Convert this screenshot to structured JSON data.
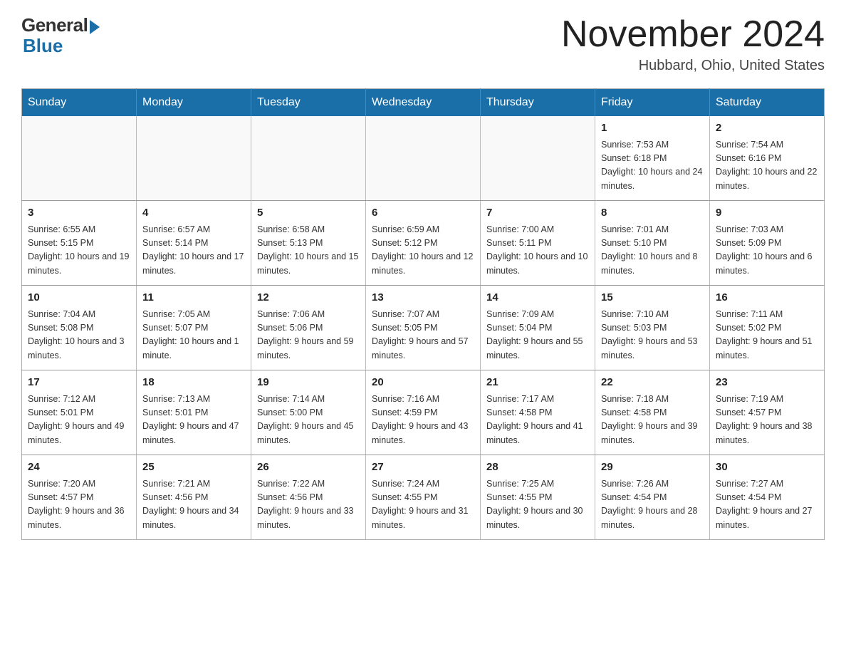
{
  "logo": {
    "general": "General",
    "blue": "Blue"
  },
  "title": "November 2024",
  "location": "Hubbard, Ohio, United States",
  "days_of_week": [
    "Sunday",
    "Monday",
    "Tuesday",
    "Wednesday",
    "Thursday",
    "Friday",
    "Saturday"
  ],
  "weeks": [
    [
      {
        "day": "",
        "info": ""
      },
      {
        "day": "",
        "info": ""
      },
      {
        "day": "",
        "info": ""
      },
      {
        "day": "",
        "info": ""
      },
      {
        "day": "",
        "info": ""
      },
      {
        "day": "1",
        "info": "Sunrise: 7:53 AM\nSunset: 6:18 PM\nDaylight: 10 hours and 24 minutes."
      },
      {
        "day": "2",
        "info": "Sunrise: 7:54 AM\nSunset: 6:16 PM\nDaylight: 10 hours and 22 minutes."
      }
    ],
    [
      {
        "day": "3",
        "info": "Sunrise: 6:55 AM\nSunset: 5:15 PM\nDaylight: 10 hours and 19 minutes."
      },
      {
        "day": "4",
        "info": "Sunrise: 6:57 AM\nSunset: 5:14 PM\nDaylight: 10 hours and 17 minutes."
      },
      {
        "day": "5",
        "info": "Sunrise: 6:58 AM\nSunset: 5:13 PM\nDaylight: 10 hours and 15 minutes."
      },
      {
        "day": "6",
        "info": "Sunrise: 6:59 AM\nSunset: 5:12 PM\nDaylight: 10 hours and 12 minutes."
      },
      {
        "day": "7",
        "info": "Sunrise: 7:00 AM\nSunset: 5:11 PM\nDaylight: 10 hours and 10 minutes."
      },
      {
        "day": "8",
        "info": "Sunrise: 7:01 AM\nSunset: 5:10 PM\nDaylight: 10 hours and 8 minutes."
      },
      {
        "day": "9",
        "info": "Sunrise: 7:03 AM\nSunset: 5:09 PM\nDaylight: 10 hours and 6 minutes."
      }
    ],
    [
      {
        "day": "10",
        "info": "Sunrise: 7:04 AM\nSunset: 5:08 PM\nDaylight: 10 hours and 3 minutes."
      },
      {
        "day": "11",
        "info": "Sunrise: 7:05 AM\nSunset: 5:07 PM\nDaylight: 10 hours and 1 minute."
      },
      {
        "day": "12",
        "info": "Sunrise: 7:06 AM\nSunset: 5:06 PM\nDaylight: 9 hours and 59 minutes."
      },
      {
        "day": "13",
        "info": "Sunrise: 7:07 AM\nSunset: 5:05 PM\nDaylight: 9 hours and 57 minutes."
      },
      {
        "day": "14",
        "info": "Sunrise: 7:09 AM\nSunset: 5:04 PM\nDaylight: 9 hours and 55 minutes."
      },
      {
        "day": "15",
        "info": "Sunrise: 7:10 AM\nSunset: 5:03 PM\nDaylight: 9 hours and 53 minutes."
      },
      {
        "day": "16",
        "info": "Sunrise: 7:11 AM\nSunset: 5:02 PM\nDaylight: 9 hours and 51 minutes."
      }
    ],
    [
      {
        "day": "17",
        "info": "Sunrise: 7:12 AM\nSunset: 5:01 PM\nDaylight: 9 hours and 49 minutes."
      },
      {
        "day": "18",
        "info": "Sunrise: 7:13 AM\nSunset: 5:01 PM\nDaylight: 9 hours and 47 minutes."
      },
      {
        "day": "19",
        "info": "Sunrise: 7:14 AM\nSunset: 5:00 PM\nDaylight: 9 hours and 45 minutes."
      },
      {
        "day": "20",
        "info": "Sunrise: 7:16 AM\nSunset: 4:59 PM\nDaylight: 9 hours and 43 minutes."
      },
      {
        "day": "21",
        "info": "Sunrise: 7:17 AM\nSunset: 4:58 PM\nDaylight: 9 hours and 41 minutes."
      },
      {
        "day": "22",
        "info": "Sunrise: 7:18 AM\nSunset: 4:58 PM\nDaylight: 9 hours and 39 minutes."
      },
      {
        "day": "23",
        "info": "Sunrise: 7:19 AM\nSunset: 4:57 PM\nDaylight: 9 hours and 38 minutes."
      }
    ],
    [
      {
        "day": "24",
        "info": "Sunrise: 7:20 AM\nSunset: 4:57 PM\nDaylight: 9 hours and 36 minutes."
      },
      {
        "day": "25",
        "info": "Sunrise: 7:21 AM\nSunset: 4:56 PM\nDaylight: 9 hours and 34 minutes."
      },
      {
        "day": "26",
        "info": "Sunrise: 7:22 AM\nSunset: 4:56 PM\nDaylight: 9 hours and 33 minutes."
      },
      {
        "day": "27",
        "info": "Sunrise: 7:24 AM\nSunset: 4:55 PM\nDaylight: 9 hours and 31 minutes."
      },
      {
        "day": "28",
        "info": "Sunrise: 7:25 AM\nSunset: 4:55 PM\nDaylight: 9 hours and 30 minutes."
      },
      {
        "day": "29",
        "info": "Sunrise: 7:26 AM\nSunset: 4:54 PM\nDaylight: 9 hours and 28 minutes."
      },
      {
        "day": "30",
        "info": "Sunrise: 7:27 AM\nSunset: 4:54 PM\nDaylight: 9 hours and 27 minutes."
      }
    ]
  ]
}
